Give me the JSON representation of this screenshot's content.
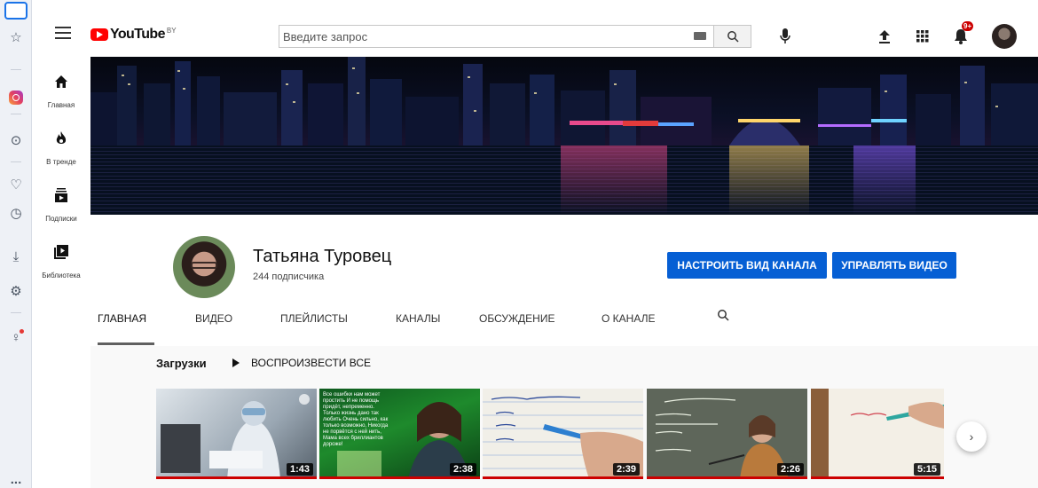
{
  "topbar": {
    "logo_text": "YouTube",
    "country_code": "BY",
    "search_placeholder": "Введите запрос",
    "notifications_badge": "9+"
  },
  "guide": {
    "items": [
      {
        "label": "Главная",
        "icon": "home-icon"
      },
      {
        "label": "В тренде",
        "icon": "fire-icon"
      },
      {
        "label": "Подписки",
        "icon": "subscriptions-icon"
      },
      {
        "label": "Библиотека",
        "icon": "library-icon"
      }
    ]
  },
  "browser_rail": {
    "icons": [
      "browser-home-icon",
      "star-icon",
      "instagram-icon",
      "play-circle-icon",
      "heart-icon",
      "history-icon",
      "download-icon",
      "settings-icon",
      "lightbulb-icon",
      "more-icon"
    ],
    "more_label": "..."
  },
  "channel": {
    "name": "Татьяна Туровец",
    "subscribers": "244 подписчика",
    "customize_button": "НАСТРОИТЬ ВИД КАНАЛА",
    "manage_button": "УПРАВЛЯТЬ ВИДЕО",
    "button_color": "#065fd4"
  },
  "tabs": [
    {
      "label": "ГЛАВНАЯ",
      "active": true
    },
    {
      "label": "ВИДЕО",
      "active": false
    },
    {
      "label": "ПЛЕЙЛИСТЫ",
      "active": false
    },
    {
      "label": "КАНАЛЫ",
      "active": false
    },
    {
      "label": "ОБСУЖДЕНИЕ",
      "active": false
    },
    {
      "label": "О КАНАЛЕ",
      "active": false
    }
  ],
  "shelf": {
    "title": "Загрузки",
    "play_all": "ВОСПРОИЗВЕСТИ ВСЕ",
    "videos": [
      {
        "duration": "1:43",
        "progress": 1.0
      },
      {
        "duration": "2:38",
        "progress": 1.0,
        "overlay_text": "Все ошибки нам может простить И не помощь придёт, непременно. Только жизнь дано так любить Очень сильно, как только возможно, Никогда не порвётся с ней нить, Мама всех бриллиантов дороже!"
      },
      {
        "duration": "2:39",
        "progress": 1.0
      },
      {
        "duration": "2:26",
        "progress": 1.0
      },
      {
        "duration": "5:15",
        "progress": 1.0
      }
    ]
  }
}
